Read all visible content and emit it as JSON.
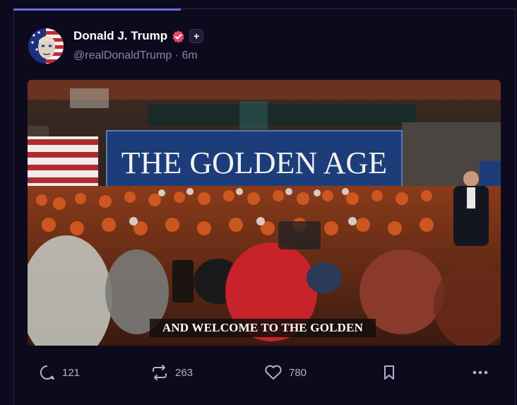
{
  "post": {
    "display_name": "Donald J. Trump",
    "handle": "@realDonaldTrump",
    "separator": "·",
    "time": "6m",
    "media": {
      "banner_text": "THE GOLDEN AGE",
      "caption": "AND WELCOME TO THE GOLDEN"
    }
  },
  "actions": {
    "replies": "121",
    "reposts": "263",
    "likes": "780"
  },
  "colors": {
    "background": "#0d0a1e",
    "progress": "#6f6cf0",
    "verified": "#e8456b",
    "banner": "#1d3d7a"
  },
  "icons": [
    "verified-badge-icon",
    "plus-icon",
    "reply-icon",
    "repost-icon",
    "heart-icon",
    "bookmark-icon",
    "more-icon"
  ]
}
